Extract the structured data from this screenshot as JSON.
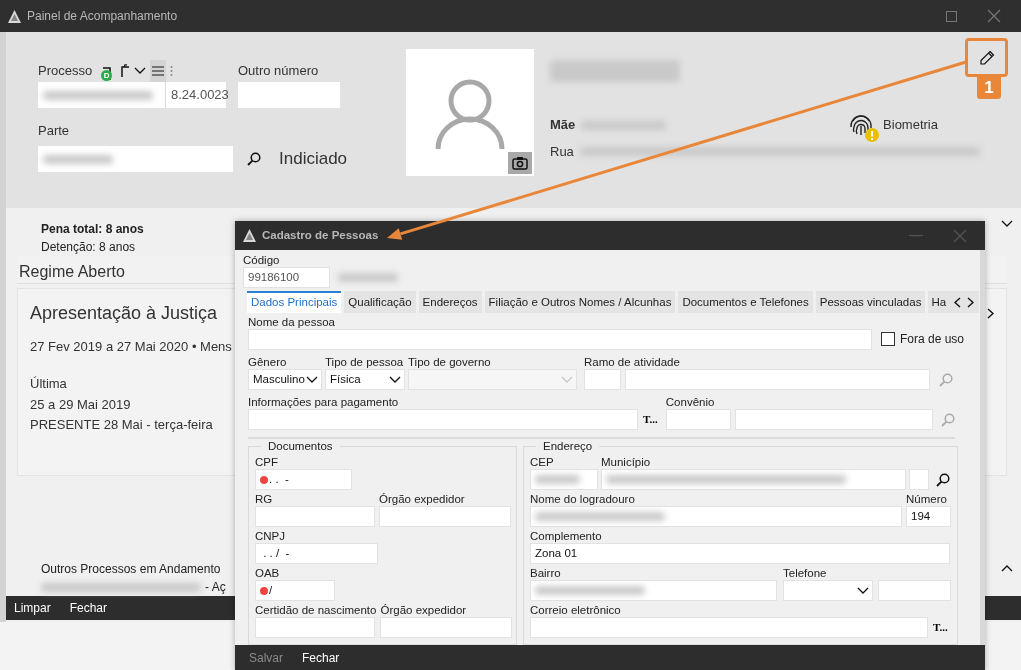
{
  "main_window": {
    "title": "Painel de Acompanhamento",
    "processo": {
      "label": "Processo",
      "doc_badge": "D",
      "number_end": "8.24.0023"
    },
    "outro_numero": {
      "label": "Outro número"
    },
    "parte": {
      "label": "Parte",
      "role": "Indiciado"
    },
    "person": {
      "mother_label": "Mãe",
      "street_label": "Rua",
      "biometry": {
        "label": "Biometria",
        "warning": true
      }
    },
    "sentence": {
      "total": "Pena total: 8 anos",
      "detention": "Detenção: 8 anos"
    },
    "regime": "Regime Aberto",
    "presentation": {
      "title": "Apresentação à Justiça",
      "period": "27 Fev 2019 a 27 Mai 2020 • Mens",
      "last_label": "Última",
      "last_period": "25 a 29 Mai 2019",
      "last_status": "PRESENTE 28 Mai - terça-feira"
    },
    "other_processes": {
      "title": "Outros Processos em Andamento",
      "row_suffix": "- Aç"
    },
    "footer_buttons": [
      {
        "label": "Limpar",
        "disabled": false
      },
      {
        "label": "Fechar",
        "disabled": false
      }
    ]
  },
  "annotation": {
    "number": "1"
  },
  "dialog": {
    "title": "Cadastro de Pessoas",
    "code": {
      "label": "Código",
      "value": "99186100"
    },
    "tabs": [
      {
        "label": "Dados Principais",
        "selected": true
      },
      {
        "label": "Qualificação",
        "selected": false
      },
      {
        "label": "Endereços",
        "selected": false
      },
      {
        "label": "Filiação e Outros Nomes / Alcunhas",
        "selected": false
      },
      {
        "label": "Documentos e Telefones",
        "selected": false
      },
      {
        "label": "Pessoas vinculadas",
        "selected": false
      },
      {
        "label": "Ha",
        "selected": false
      }
    ],
    "name": {
      "label": "Nome da pessoa"
    },
    "out_of_use": {
      "label": "Fora de uso",
      "checked": false
    },
    "gender": {
      "label": "Gênero",
      "value": "Masculino"
    },
    "person_type": {
      "label": "Tipo de pessoa",
      "value": "Física"
    },
    "government_type": {
      "label": "Tipo de governo",
      "disabled": true
    },
    "activity": {
      "label": "Ramo de atividade"
    },
    "payment": {
      "label": "Informações para pagamento",
      "button": "T..."
    },
    "agreement": {
      "label": "Convênio"
    },
    "documents": {
      "title": "Documentos",
      "cpf": {
        "label": "CPF",
        "value": ". .  -",
        "required": true
      },
      "rg": {
        "label": "RG"
      },
      "rg_issuer": {
        "label": "Órgão expedidor"
      },
      "cnpj": {
        "label": "CNPJ",
        "value": " . . /  -"
      },
      "oab": {
        "label": "OAB",
        "value": "/",
        "required": true
      },
      "birth_cert": {
        "label": "Certidão de nascimento"
      },
      "birth_issuer": {
        "label": "Órgão expedidor"
      }
    },
    "address": {
      "title": "Endereço",
      "cep": {
        "label": "CEP"
      },
      "city": {
        "label": "Município"
      },
      "street": {
        "label": "Nome do logradouro"
      },
      "number": {
        "label": "Número",
        "value": "194"
      },
      "complement": {
        "label": "Complemento",
        "value": "Zona 01"
      },
      "district": {
        "label": "Bairro"
      },
      "phone": {
        "label": "Telefone"
      },
      "email": {
        "label": "Correio eletrônico",
        "button": "T..."
      }
    },
    "footer_buttons": [
      {
        "label": "Salvar",
        "disabled": true
      },
      {
        "label": "Fechar",
        "disabled": false
      }
    ]
  }
}
